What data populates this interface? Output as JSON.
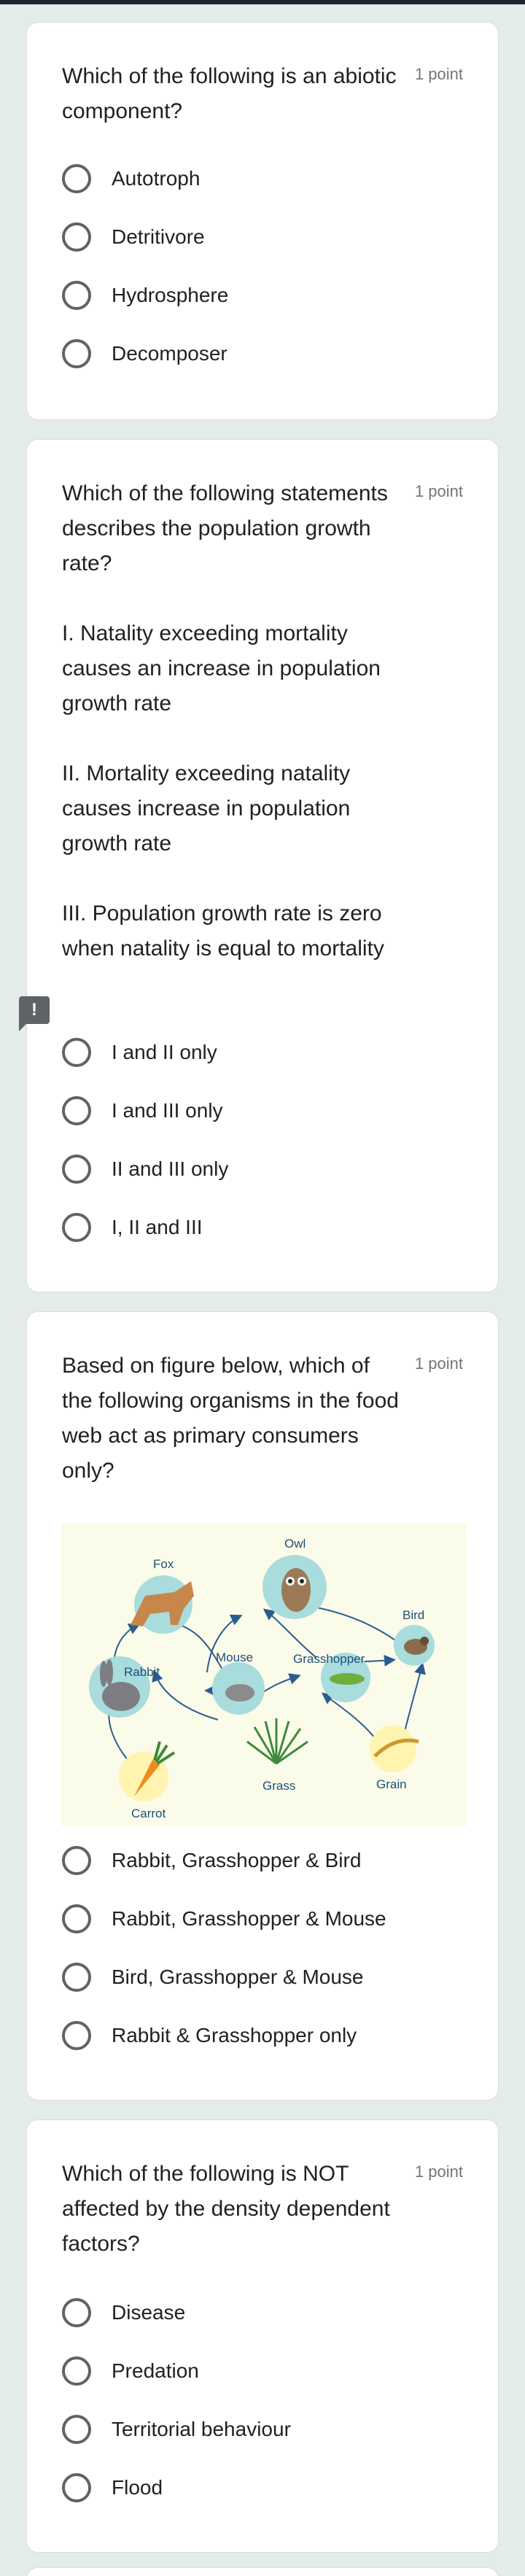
{
  "questions": [
    {
      "text": " Which of the following is an abiotic component?",
      "points": "1 point",
      "options": [
        "Autotroph",
        "Detritivore",
        "Hydrosphere",
        "Decomposer"
      ]
    },
    {
      "text": "Which of the following statements describes the population growth rate?\n\nI. Natality exceeding mortality causes an increase in population growth rate\n\nII. Mortality exceeding natality causes increase in population growth rate\n\nIII. Population growth rate is zero when natality is equal to mortality",
      "points": "1 point",
      "options": [
        "I and II only",
        "I and III only",
        "II and III only",
        "I, II and III"
      ]
    },
    {
      "text": "Based on figure below, which of the following organisms in the food web act as primary consumers only?",
      "points": "1 point",
      "figure_labels": {
        "fox": "Fox",
        "owl": "Owl",
        "bird": "Bird",
        "rabbit": "Rabbit",
        "mouse": "Mouse",
        "grasshopper": "Grasshopper",
        "grass": "Grass",
        "grain": "Grain",
        "carrot": "Carrot"
      },
      "options": [
        "Rabbit, Grasshopper & Bird",
        "Rabbit, Grasshopper & Mouse",
        "Bird, Grasshopper & Mouse",
        "Rabbit & Grasshopper only"
      ]
    },
    {
      "text": "Which of the following is NOT affected by the density dependent factors?",
      "points": "1 point",
      "options": [
        "Disease",
        "Predation",
        "Territorial behaviour",
        "Flood"
      ]
    }
  ],
  "warning_icon": "exclamation-icon",
  "colors": {
    "page_bg": "#e4ece9",
    "card_bg": "#ffffff",
    "radio": "#5f6368",
    "figure_bg": "#fbfbe9"
  }
}
